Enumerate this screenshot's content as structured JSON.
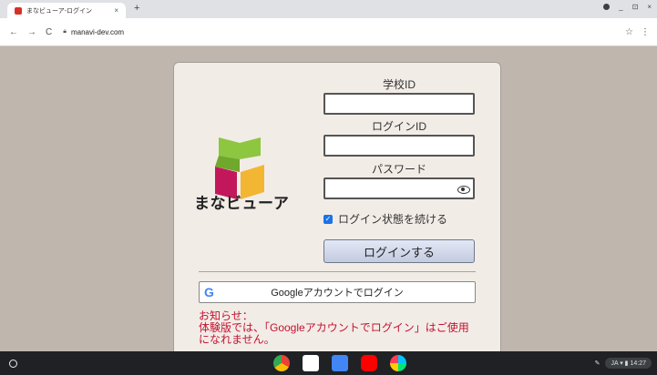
{
  "browser": {
    "tab_title": "まなビューア-ログイン",
    "tab_close": "×",
    "new_tab": "+",
    "url": "manavi-dev.com",
    "nav_back": "←",
    "nav_forward": "→",
    "nav_reload": "C",
    "bookmark": "☆",
    "menu": "⋮",
    "win_min": "_",
    "win_max": "⊡",
    "win_close": "×"
  },
  "login": {
    "brand": "まなビューア",
    "school_id_label": "学校ID",
    "login_id_label": "ログインID",
    "password_label": "パスワード",
    "school_id_value": "",
    "login_id_value": "",
    "password_value": "",
    "remember_label": "ログイン状態を続ける",
    "remember_checked": true,
    "submit_label": "ログインする",
    "google_icon": "G",
    "google_label": "Googleアカウントでログイン",
    "notice_title": "お知らせ：",
    "notice_body": "体験版では、「Googleアカウントでログイン」はご使用になれません。"
  },
  "shelf": {
    "lang": "JA",
    "time": "14:27"
  },
  "colors": {
    "background": "#bfb6ae",
    "card": "#f2ece7",
    "notice": "#c4122f",
    "logo_green": "#8dc63f",
    "logo_magenta": "#c2185b",
    "logo_yellow": "#f2b632"
  }
}
